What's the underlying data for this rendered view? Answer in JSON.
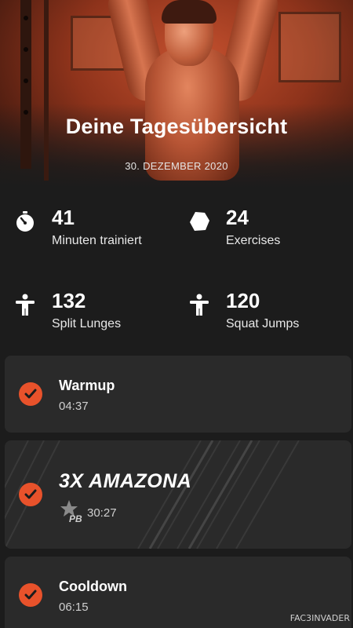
{
  "header": {
    "title": "Deine Tagesübersicht",
    "date": "30. DEZEMBER 2020"
  },
  "stats": [
    {
      "icon": "stopwatch-icon",
      "value": "41",
      "label": "Minuten trainiert"
    },
    {
      "icon": "exercises-hexagon-icon",
      "value": "24",
      "label": "Exercises"
    },
    {
      "icon": "person-icon",
      "value": "132",
      "label": "Split Lunges"
    },
    {
      "icon": "person-icon",
      "value": "120",
      "label": "Squat Jumps"
    }
  ],
  "workouts": [
    {
      "name": "Warmup",
      "time": "04:37",
      "completed": true
    },
    {
      "name": "3X AMAZONA",
      "time": "30:27",
      "completed": true,
      "badge": "PB"
    },
    {
      "name": "Cooldown",
      "time": "06:15",
      "completed": true
    }
  ],
  "watermark": "FAC3INVADER",
  "colors": {
    "accent": "#e8522b",
    "card_bg": "#2a2a2a",
    "page_bg": "#1c1c1c"
  }
}
